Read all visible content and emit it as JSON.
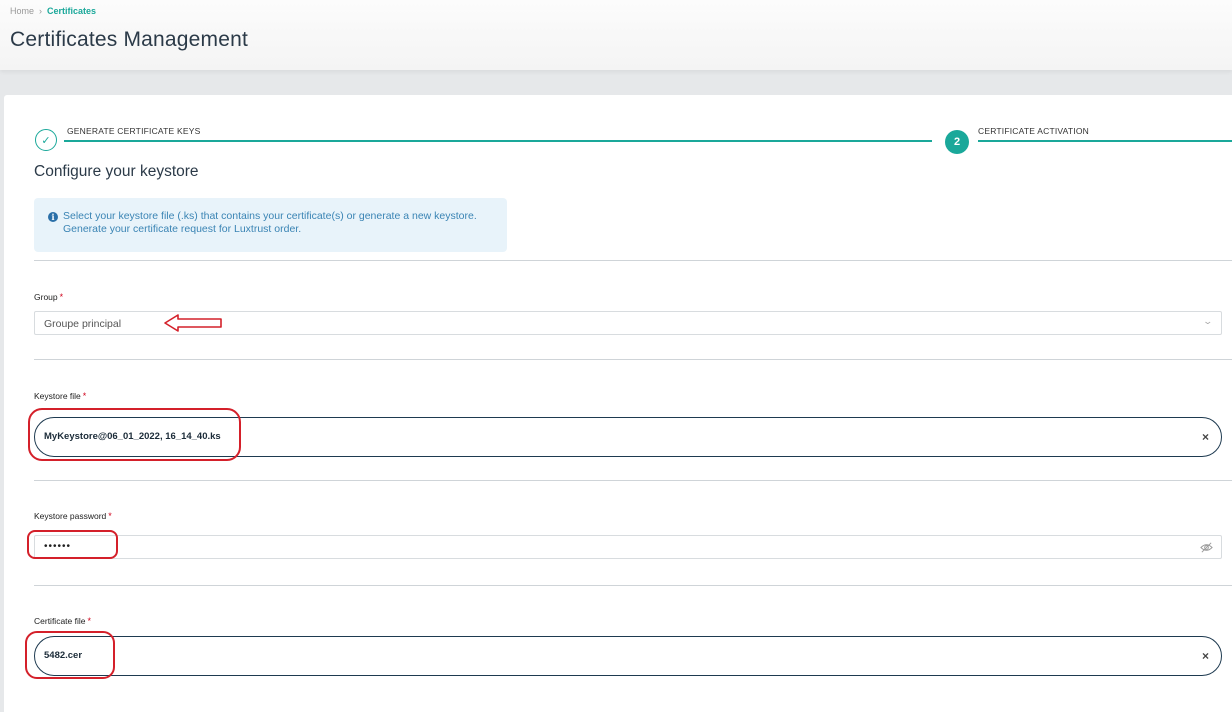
{
  "breadcrumb": {
    "home": "Home",
    "separator": "›",
    "current": "Certificates"
  },
  "page_title": "Certificates Management",
  "stepper": {
    "step1": {
      "icon": "check-icon",
      "label": "GENERATE CERTIFICATE KEYS"
    },
    "step2": {
      "number": "2",
      "label": "CERTIFICATE ACTIVATION"
    }
  },
  "section_title": "Configure your keystore",
  "info": {
    "icon": "info-icon",
    "line1": "Select your keystore file (.ks) that contains your certificate(s) or generate a new keystore.",
    "line2": "Generate your certificate request for Luxtrust order."
  },
  "group": {
    "label": "Group",
    "required": "*",
    "value": "Groupe principal",
    "icon": "chevron-down-icon"
  },
  "keystore_file": {
    "label": "Keystore file",
    "required": "*",
    "value": "MyKeystore@06_01_2022, 16_14_40.ks",
    "clear": "×"
  },
  "keystore_password": {
    "label": "Keystore password",
    "required": "*",
    "value": "••••••",
    "icon": "eye-slash-icon"
  },
  "certificate_file": {
    "label": "Certificate file",
    "required": "*",
    "value": "5482.cer",
    "clear": "×"
  },
  "colors": {
    "accent": "#1aa89a",
    "annotation": "#d4202a",
    "info_text": "#3a84b4",
    "info_bg": "#e8f3fa"
  }
}
